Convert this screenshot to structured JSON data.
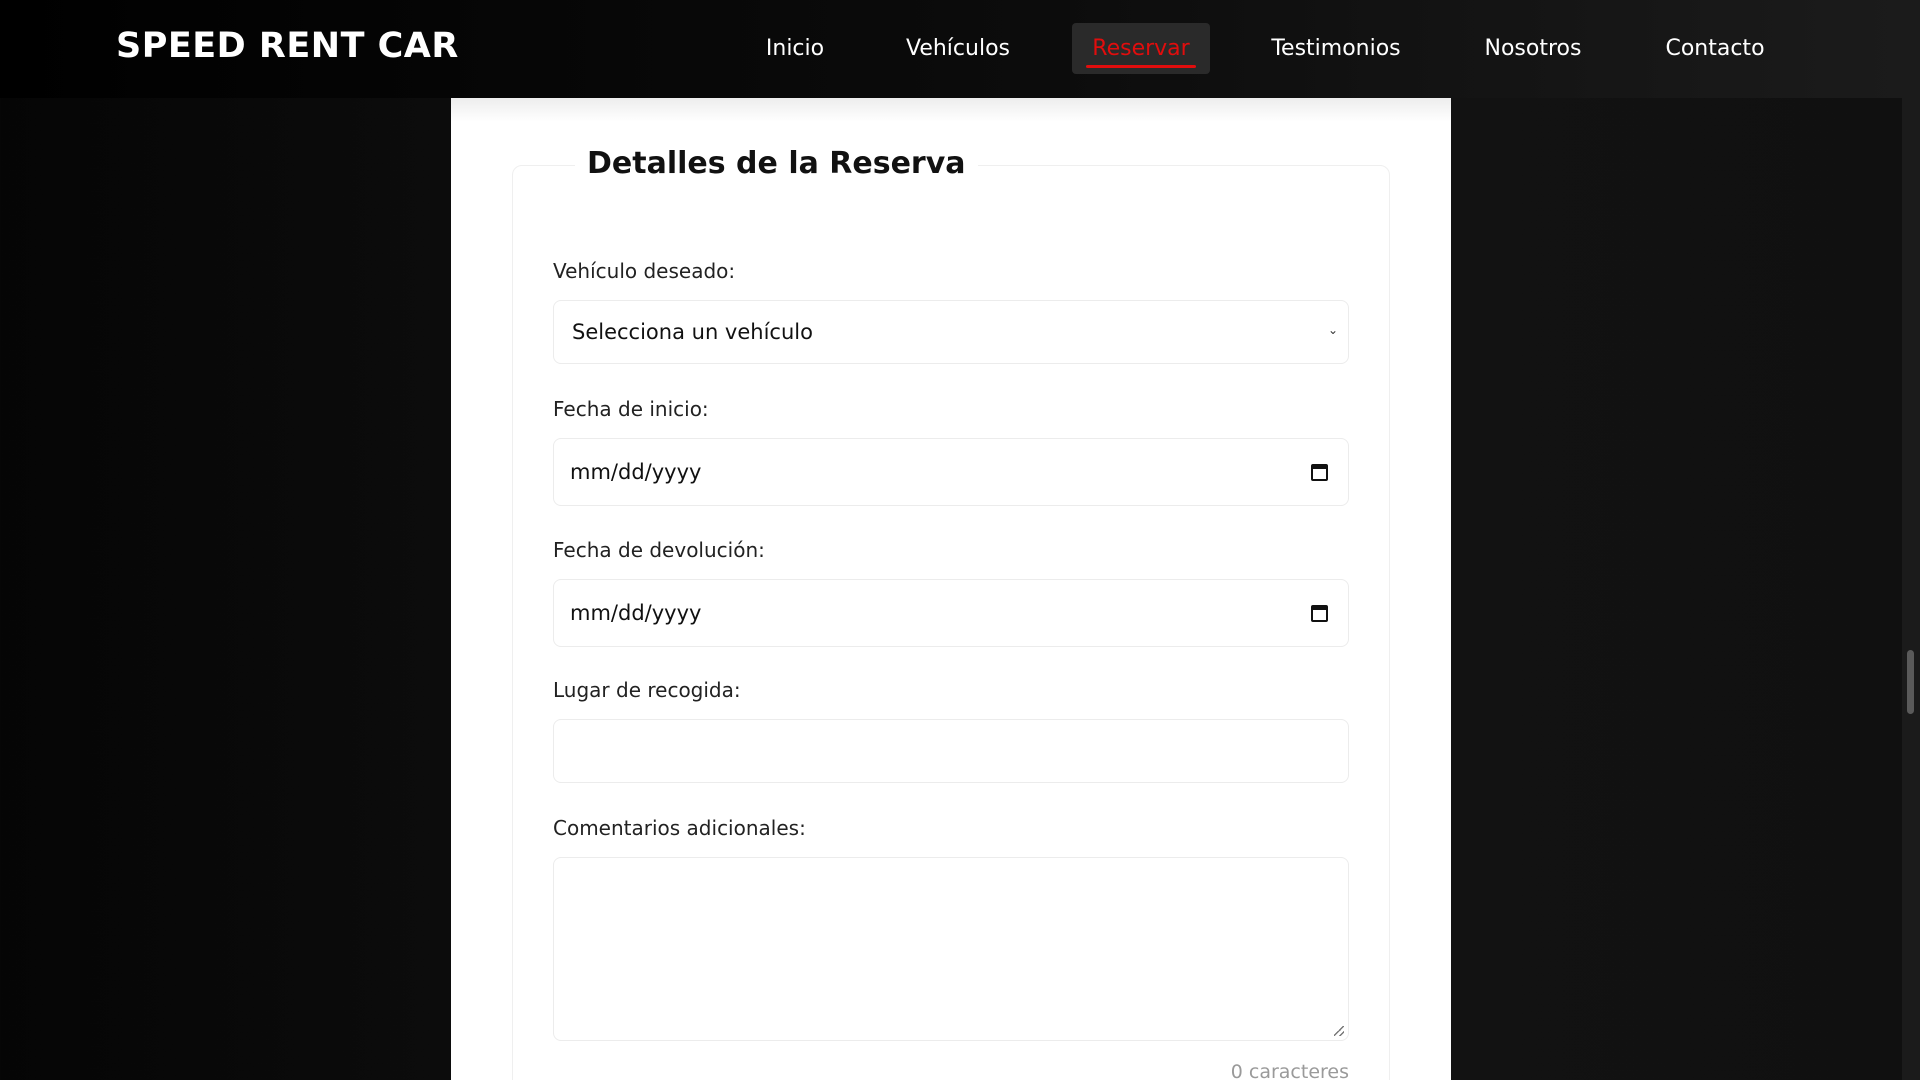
{
  "header": {
    "brand": "SPEED RENT CAR",
    "nav": [
      {
        "label": "Inicio",
        "active": false
      },
      {
        "label": "Vehículos",
        "active": false
      },
      {
        "label": "Reservar",
        "active": true
      },
      {
        "label": "Testimonios",
        "active": false
      },
      {
        "label": "Nosotros",
        "active": false
      },
      {
        "label": "Contacto",
        "active": false
      }
    ]
  },
  "form": {
    "legend": "Detalles de la Reserva",
    "vehicle": {
      "label": "Vehículo deseado:",
      "selected": "Selecciona un vehículo",
      "icon": "chevron-down-icon"
    },
    "start_date": {
      "label": "Fecha de inicio:",
      "placeholder": "mm/dd/yyyy",
      "icon": "calendar-icon"
    },
    "return_date": {
      "label": "Fecha de devolución:",
      "placeholder": "mm/dd/yyyy",
      "icon": "calendar-icon"
    },
    "pickup_location": {
      "label": "Lugar de recogida:",
      "value": ""
    },
    "comments": {
      "label": "Comentarios adicionales:",
      "value": "",
      "char_count": "0 caracteres"
    }
  },
  "colors": {
    "accent": "#e10d0d",
    "header_bg": "#000000",
    "page_bg": "#0d0d0d",
    "card_bg": "#ffffff"
  }
}
